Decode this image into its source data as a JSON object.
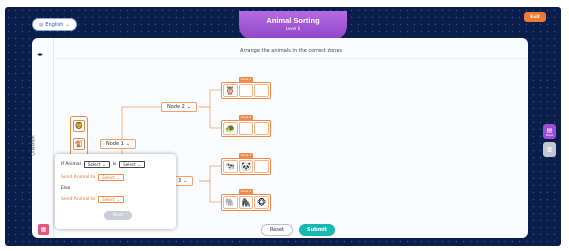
{
  "language": {
    "label": "English",
    "icon": "globe-icon"
  },
  "header": {
    "title": "Animal Sorting",
    "level": "Level 6",
    "exit_label": "Exit"
  },
  "rail": {
    "collapse_icon": "collapse-icon",
    "question_label": "Question"
  },
  "instruction": "Arrange the animals in the correct zones",
  "animal_bank": [
    "🦁",
    "🐒",
    "🦓",
    "🐧"
  ],
  "nodes": {
    "node1": "Node 1",
    "node2": "Node 2",
    "node3": "3"
  },
  "zones": [
    {
      "label": "Zone 1",
      "items": [
        "🦉",
        "",
        ""
      ]
    },
    {
      "label": "Zone 2",
      "items": [
        "🐢",
        "",
        ""
      ]
    },
    {
      "label": "Zone 3",
      "items": [
        "🐄",
        "🐼",
        ""
      ]
    },
    {
      "label": "Zone 4",
      "items": [
        "🐘",
        "🦍",
        "🐵"
      ]
    }
  ],
  "popup": {
    "if_label": "If Animal",
    "select1": "Select",
    "is_label": "is",
    "select2": "Select",
    "send_then": "Send Animal to",
    "select3": "Select",
    "else_label": "Else",
    "send_else": "Send Animal to",
    "select4": "Select",
    "next_label": "Next"
  },
  "footer": {
    "reset_label": "Reset",
    "submit_label": "Submit"
  },
  "side_buttons": {
    "hint_label": "Notes",
    "second_label": ""
  },
  "colors": {
    "accent": "#f08a4b",
    "brand_purple": "#9b50d2",
    "submit": "#19b8b0",
    "background": "#0b1d4a"
  }
}
